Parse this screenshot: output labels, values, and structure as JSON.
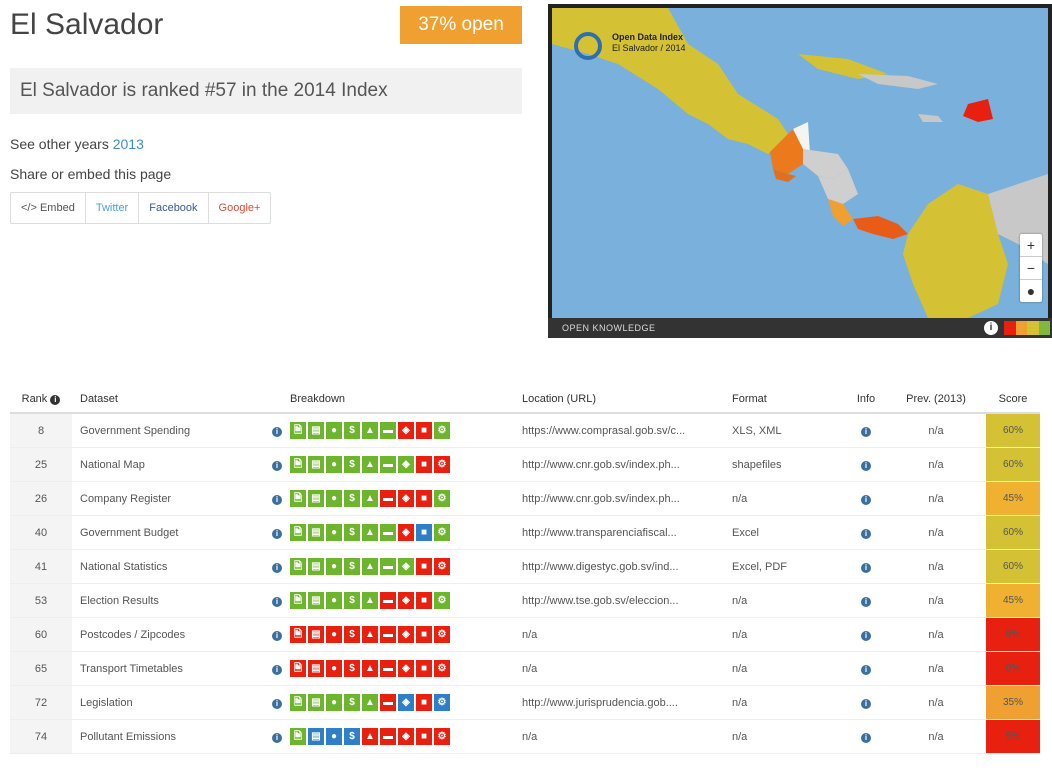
{
  "page": {
    "title": "El Salvador",
    "open_badge": "37% open",
    "rank_text": "El Salvador is ranked #57 in the 2014 Index",
    "other_years_label": "See other years",
    "other_years_link": "2013",
    "share_label": "Share or embed this page",
    "share_buttons": [
      "</> Embed",
      "Twitter",
      "Facebook",
      "Google+"
    ]
  },
  "map": {
    "label_line1": "Open Data Index",
    "label_line2": "El Salvador / 2014",
    "footer_brand": "OPEN KNOWLEDGE",
    "zoom_in": "+",
    "zoom_out": "−",
    "locate": "●",
    "info": "i",
    "scale_colors": [
      "#e82010",
      "#f0a030",
      "#d4c234",
      "#80b840"
    ]
  },
  "table": {
    "headers": {
      "rank": "Rank",
      "dataset": "Dataset",
      "breakdown": "Breakdown",
      "location": "Location (URL)",
      "format": "Format",
      "info": "Info",
      "prev": "Prev. (2013)",
      "score": "Score"
    },
    "rows": [
      {
        "rank": "8",
        "dataset": "Government Spending",
        "location": "https://www.comprasal.gob.sv/c...",
        "format": "XLS, XML",
        "prev": "n/a",
        "score": "60%",
        "score_color": "#d4c234",
        "breakdown": [
          "g",
          "g",
          "g",
          "g",
          "g",
          "g",
          "r",
          "r",
          "g"
        ]
      },
      {
        "rank": "25",
        "dataset": "National Map",
        "location": "http://www.cnr.gob.sv/index.ph...",
        "format": "shapefiles",
        "prev": "n/a",
        "score": "60%",
        "score_color": "#d4c234",
        "breakdown": [
          "g",
          "g",
          "g",
          "g",
          "g",
          "g",
          "g",
          "r",
          "r"
        ]
      },
      {
        "rank": "26",
        "dataset": "Company Register",
        "location": "http://www.cnr.gob.sv/index.ph...",
        "format": "n/a",
        "prev": "n/a",
        "score": "45%",
        "score_color": "#f0b030",
        "breakdown": [
          "g",
          "g",
          "g",
          "g",
          "g",
          "r",
          "r",
          "r",
          "g"
        ]
      },
      {
        "rank": "40",
        "dataset": "Government Budget",
        "location": "http://www.transparenciafiscal...",
        "format": "Excel",
        "prev": "n/a",
        "score": "60%",
        "score_color": "#d4c234",
        "breakdown": [
          "g",
          "g",
          "g",
          "g",
          "g",
          "g",
          "r",
          "b",
          "g"
        ]
      },
      {
        "rank": "41",
        "dataset": "National Statistics",
        "location": "http://www.digestyc.gob.sv/ind...",
        "format": "Excel, PDF",
        "prev": "n/a",
        "score": "60%",
        "score_color": "#d4c234",
        "breakdown": [
          "g",
          "g",
          "g",
          "g",
          "g",
          "g",
          "g",
          "r",
          "r"
        ]
      },
      {
        "rank": "53",
        "dataset": "Election Results",
        "location": "http://www.tse.gob.sv/eleccion...",
        "format": "n/a",
        "prev": "n/a",
        "score": "45%",
        "score_color": "#f0b030",
        "breakdown": [
          "g",
          "g",
          "g",
          "g",
          "g",
          "r",
          "r",
          "r",
          "g"
        ]
      },
      {
        "rank": "60",
        "dataset": "Postcodes / Zipcodes",
        "location": "n/a",
        "format": "n/a",
        "prev": "n/a",
        "score": "0%",
        "score_color": "#e82010",
        "breakdown": [
          "r",
          "r",
          "r",
          "r",
          "r",
          "r",
          "r",
          "r",
          "r"
        ]
      },
      {
        "rank": "65",
        "dataset": "Transport Timetables",
        "location": "n/a",
        "format": "n/a",
        "prev": "n/a",
        "score": "0%",
        "score_color": "#e82010",
        "breakdown": [
          "r",
          "r",
          "r",
          "r",
          "r",
          "r",
          "r",
          "r",
          "r"
        ]
      },
      {
        "rank": "72",
        "dataset": "Legislation",
        "location": "http://www.jurisprudencia.gob....",
        "format": "n/a",
        "prev": "n/a",
        "score": "35%",
        "score_color": "#f0a030",
        "breakdown": [
          "g",
          "g",
          "g",
          "g",
          "g",
          "r",
          "b",
          "r",
          "b"
        ]
      },
      {
        "rank": "74",
        "dataset": "Pollutant Emissions",
        "location": "n/a",
        "format": "n/a",
        "prev": "n/a",
        "score": "5%",
        "score_color": "#e82010",
        "breakdown": [
          "g",
          "b",
          "b",
          "b",
          "r",
          "r",
          "r",
          "r",
          "r"
        ]
      }
    ],
    "breakdown_icons": [
      "🗎",
      "▤",
      "●",
      "$",
      "▲",
      "▬",
      "◈",
      "■",
      "⚙"
    ],
    "colors": {
      "g": "#6cb52d",
      "r": "#e82010",
      "b": "#2f7fc8"
    }
  }
}
